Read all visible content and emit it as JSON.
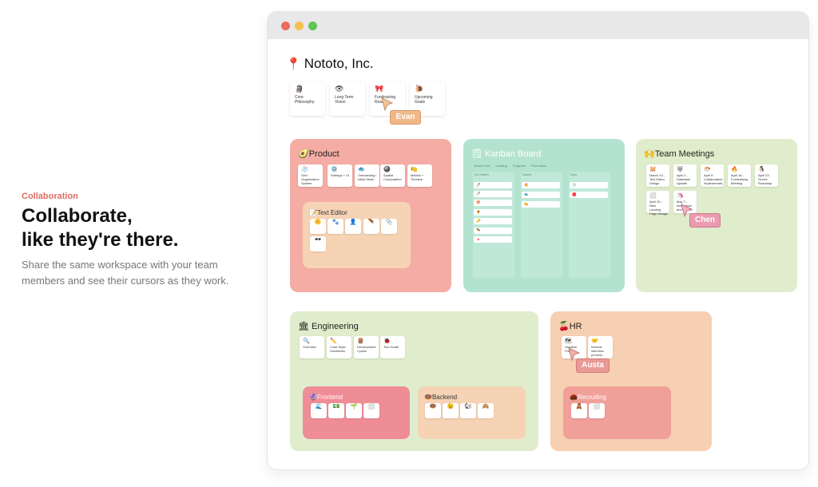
{
  "hero": {
    "eyebrow": "Collaboration",
    "headline_line1": "Collaborate,",
    "headline_line2": "like they're there.",
    "description": "Share the same workspace with your team members and see their cursors as they work."
  },
  "workspace": {
    "title": "Nototo, Inc.",
    "title_icon": "📍",
    "top_cards": [
      {
        "icon": "🗿",
        "label": "Core Philosophy"
      },
      {
        "icon": "👁",
        "label": "Long Term Vision"
      },
      {
        "icon": "🎀",
        "label": "Fundraising Road..."
      },
      {
        "icon": "🐌",
        "label": "Upcoming Goals"
      }
    ]
  },
  "sections": {
    "product": {
      "title": "Product",
      "icon": "🥑",
      "cards": [
        {
          "icon": "🧦",
          "label": "Grid Organization System"
        },
        {
          "icon": "⚙️",
          "label": "Settings + UI"
        },
        {
          "icon": "🐟",
          "label": "Onboarding / Initial State"
        },
        {
          "icon": "🎱",
          "label": "Spatial Computation"
        },
        {
          "icon": "🍋",
          "label": "Metrics + Timeline"
        }
      ],
      "sub": {
        "title": "Text Editor",
        "icon": "📝",
        "items": [
          "🌼",
          "🐾",
          "👤",
          "🪶",
          "📎",
          "🕶"
        ]
      }
    },
    "kanban": {
      "title": "Kanban Board",
      "icon": "🗒",
      "tabs": [
        "Board Grid",
        "Landing",
        "Progress",
        "Plan Ideas"
      ],
      "columns": [
        {
          "title": "Not Started",
          "items": [
            "🖊",
            "🖊",
            "🍄",
            "🌻",
            "🔑",
            "🪶",
            "🔺"
          ]
        },
        {
          "title": "Started",
          "items": [
            "🔥",
            "🐟",
            "🍋"
          ]
        },
        {
          "title": "Done",
          "items": [
            "🧦",
            "🔴"
          ]
        }
      ]
    },
    "meetings": {
      "title": "Team Meetings",
      "icon": "🙌",
      "cards": [
        {
          "icon": "🐹",
          "label": "March 10 - Text Editor Design"
        },
        {
          "icon": "🐺",
          "label": "April 2 - Database Update"
        },
        {
          "icon": "🐡",
          "label": "April 9 - Collaboration Implementati..."
        },
        {
          "icon": "🔥",
          "label": "April 16 - Fundraising Meeting"
        },
        {
          "icon": "🐧",
          "label": "April 23 - Secret Roadmap"
        },
        {
          "icon": "⬜",
          "label": "April 30 - New Landing Page Design"
        },
        {
          "icon": "🦄",
          "label": "May 7 - Integration and Workf..."
        }
      ]
    },
    "engineering": {
      "title": "Engineering",
      "icon": "🏛",
      "cards": [
        {
          "icon": "🔍",
          "label": "Overview"
        },
        {
          "icon": "✏️",
          "label": "Code Style Guidelines"
        },
        {
          "icon": "🪵",
          "label": "Development Cycles"
        },
        {
          "icon": "🐞",
          "label": "Tool Guide"
        }
      ],
      "frontend": {
        "title": "Frontend",
        "icon": "🔮",
        "items": [
          "🌊",
          "💵",
          "🌱",
          "⬜"
        ]
      },
      "backend": {
        "title": "Backend",
        "icon": "🍩",
        "items": [
          "🍩",
          "😉",
          "🐿",
          "🙈"
        ]
      }
    },
    "hr": {
      "title": "HR",
      "icon": "🍒",
      "cards": [
        {
          "icon": "🗺",
          "label": "Vacation Policy"
        },
        {
          "icon": "🤝",
          "label": "Internal interview process"
        }
      ],
      "sub": {
        "title": "Recruiting",
        "icon": "🌰",
        "items": [
          "🧸",
          "⬜"
        ]
      }
    }
  },
  "cursors": [
    {
      "name": "Evan",
      "color": "#f0b889"
    },
    {
      "name": "Chen",
      "color": "#ea9bb0"
    },
    {
      "name": "Austa",
      "color": "#e99a95"
    }
  ],
  "colors": {
    "product": "#f4aca4",
    "kanban": "#b3e3d0",
    "meetings": "#e0edcc",
    "engineering": "#e0edcc",
    "hr": "#f7cfb2",
    "text_editor": "#f6d3b5",
    "frontend": "#ef8d96",
    "backend": "#f6d3b5",
    "recruiting": "#f0a099",
    "eyebrow": "#e06b5f"
  }
}
